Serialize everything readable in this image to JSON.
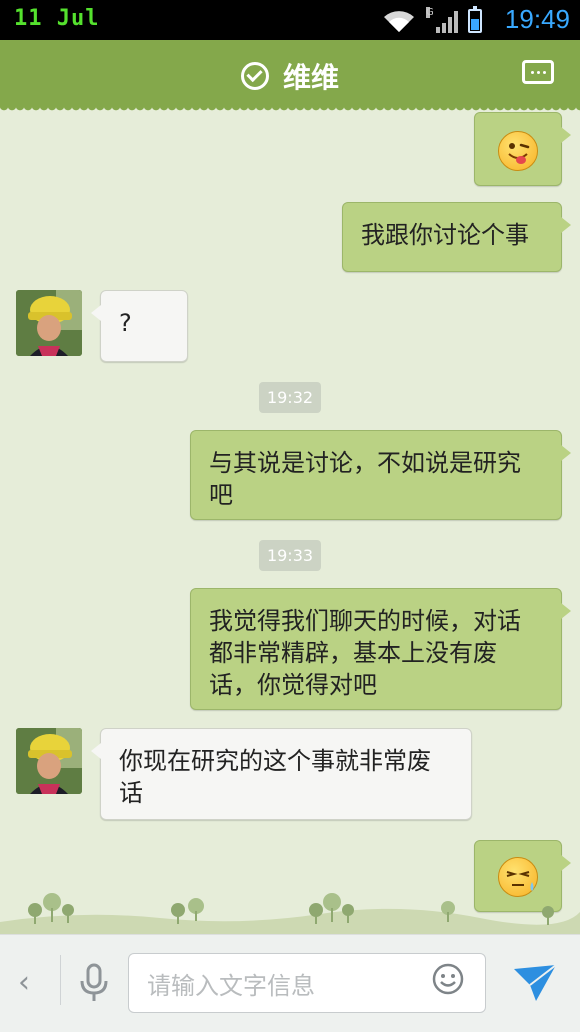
{
  "status_bar": {
    "left_text": "11 Jul",
    "time": "19:49",
    "network": "G"
  },
  "header": {
    "title": "维维"
  },
  "messages": {
    "m1_emoji": "winking-tongue-emoji",
    "m2_text": "我跟你讨论个事",
    "m3_text": "?",
    "t1": "19:32",
    "m4_text": "与其说是讨论，不如说是研究吧",
    "t2": "19:33",
    "m5_text": "我觉得我们聊天的时候，对话都非常精辟，基本上没有废话，你觉得对吧",
    "m6_text": "你现在研究的这个事就非常废话",
    "m7_emoji": "sweat-emoji"
  },
  "input": {
    "placeholder": "请输入文字信息"
  },
  "colors": {
    "header": "#84a84b",
    "outgoing_bubble": "#bad284",
    "incoming_bubble": "#f6f6f4",
    "time_accent": "#39a9ff",
    "send_icon": "#2d8fe0"
  }
}
